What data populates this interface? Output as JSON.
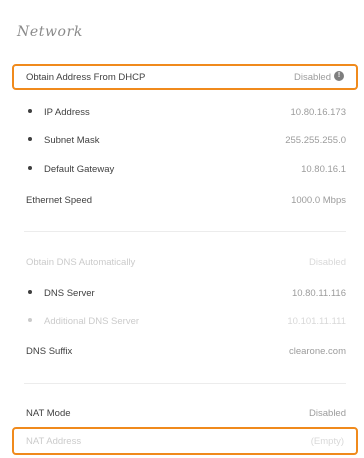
{
  "page": {
    "title": "Network"
  },
  "network": {
    "dhcp": {
      "label": "Obtain Address From DHCP",
      "value": "Disabled"
    },
    "ip_address": {
      "label": "IP Address",
      "value": "10.80.16.173"
    },
    "subnet_mask": {
      "label": "Subnet Mask",
      "value": "255.255.255.0"
    },
    "default_gateway": {
      "label": "Default Gateway",
      "value": "10.80.16.1"
    },
    "ethernet_speed": {
      "label": "Ethernet Speed",
      "value": "1000.0 Mbps"
    },
    "dns_auto": {
      "label": "Obtain DNS Automatically",
      "value": "Disabled"
    },
    "dns_server": {
      "label": "DNS Server",
      "value": "10.80.11.116"
    },
    "additional_dns": {
      "label": "Additional DNS Server",
      "value": "10.101.11.111"
    },
    "dns_suffix": {
      "label": "DNS Suffix",
      "value": "clearone.com"
    },
    "nat_mode": {
      "label": "NAT Mode",
      "value": "Disabled"
    },
    "nat_address": {
      "label": "NAT Address",
      "value": "(Empty)"
    }
  },
  "colors": {
    "highlight": "#f08a1c",
    "label": "#3f3f3f",
    "value": "#9c9c9c",
    "disabled": "#cbcbcb"
  },
  "icons": {
    "dhcp_info": "info-icon"
  }
}
